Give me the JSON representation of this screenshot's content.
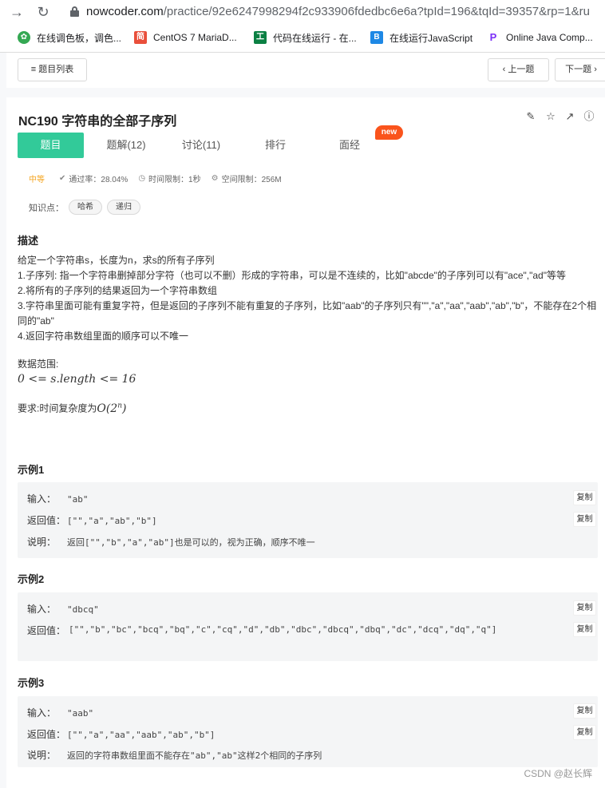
{
  "browser": {
    "url_host": "nowcoder.com",
    "url_path": "/practice/92e6247998294f2c933906fdedbc6e6a?tpId=196&tqId=39357&rp=1&ru",
    "bookmarks": [
      {
        "label": "在线调色板，调色...",
        "icon": "palette-icon",
        "color": "#34a853"
      },
      {
        "label": "CentOS 7 MariaD...",
        "icon": "jian-icon",
        "color": "#e94f3b"
      },
      {
        "label": "代码在线运行 - 在...",
        "icon": "code-icon",
        "color": "#0b8043"
      },
      {
        "label": "在线运行JavaScript",
        "icon": "b-icon",
        "color": "#1e88e5"
      },
      {
        "label": "Online Java Comp...",
        "icon": "p-icon",
        "color": "#7b2ff7"
      }
    ]
  },
  "topbar": {
    "list_label": "题目列表",
    "prev_label": "上一题",
    "next_label": "下一题"
  },
  "problem": {
    "title": "NC190  字符串的全部子序列",
    "tabs": [
      {
        "label": "题目"
      },
      {
        "label": "题解(12)"
      },
      {
        "label": "讨论(11)"
      },
      {
        "label": "排行"
      },
      {
        "label": "面经"
      }
    ],
    "new_badge": "new",
    "level": "中等",
    "pass_rate": "通过率：28.04%",
    "time_limit": "时间限制：1秒",
    "space_limit": "空间限制：256M",
    "knowledge_label": "知识点：",
    "knowledge": [
      "哈希",
      "递归"
    ]
  },
  "description": {
    "heading": "描述",
    "lines": [
      "给定一个字符串s，长度为n，求s的所有子序列",
      "1.子序列: 指一个字符串删掉部分字符（也可以不删）形成的字符串，可以是不连续的，比如\"abcde\"的子序列可以有\"ace\",\"ad\"等等",
      "2.将所有的子序列的结果返回为一个字符串数组",
      "3.字符串里面可能有重复字符，但是返回的子序列不能有重复的子序列，比如\"aab\"的子序列只有\"\",\"a\",\"aa\",\"aab\",\"ab\",\"b\"，不能存在2个相同的\"ab\"",
      "4.返回字符串数组里面的顺序可以不唯一"
    ],
    "range_label": "数据范围:",
    "range_math": "0 <= s.length <= 16",
    "req_label": "要求:时间复杂度为",
    "req_math": "O(2",
    "req_math_sup": "n",
    "req_math_end": ")"
  },
  "examples": [
    {
      "heading": "示例1",
      "input_label": "输入：",
      "input": "\"ab\"",
      "output_label": "返回值：",
      "output": "[\"\",\"a\",\"ab\",\"b\"]",
      "note_label": "说明：",
      "note": "返回[\"\",\"b\",\"a\",\"ab\"]也是可以的，视为正确，顺序不唯一",
      "copy": "复制"
    },
    {
      "heading": "示例2",
      "input_label": "输入：",
      "input": "\"dbcq\"",
      "output_label": "返回值：",
      "output": "[\"\",\"b\",\"bc\",\"bcq\",\"bq\",\"c\",\"cq\",\"d\",\"db\",\"dbc\",\"dbcq\",\"dbq\",\"dc\",\"dcq\",\"dq\",\"q\"]",
      "copy": "复制"
    },
    {
      "heading": "示例3",
      "input_label": "输入：",
      "input": "\"aab\"",
      "output_label": "返回值：",
      "output": "[\"\",\"a\",\"aa\",\"aab\",\"ab\",\"b\"]",
      "note_label": "说明：",
      "note": "返回的字符串数组里面不能存在\"ab\",\"ab\"这样2个相同的子序列",
      "copy": "复制"
    }
  ],
  "watermark": "CSDN @赵长辉"
}
